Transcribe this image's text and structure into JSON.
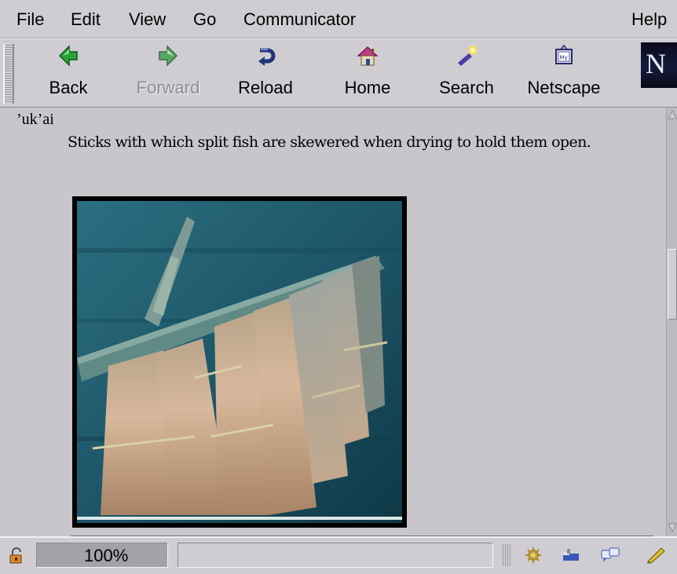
{
  "menu": {
    "items": [
      "File",
      "Edit",
      "View",
      "Go",
      "Communicator"
    ],
    "help": "Help"
  },
  "toolbar": {
    "back": "Back",
    "forward": "Forward",
    "reload": "Reload",
    "home": "Home",
    "search": "Search",
    "netscape": "Netscape",
    "logo": "N"
  },
  "content": {
    "term": "’uk’ai",
    "definition": "Sticks with which split fish are skewered when drying to hold them open."
  },
  "status": {
    "zoom": "100%"
  },
  "colors": {
    "chrome": "#cfcdd2",
    "page_background": "#c8c6cb",
    "photo_water": "#1f5a6a"
  },
  "icons": [
    "back-icon",
    "forward-icon",
    "reload-icon",
    "home-icon",
    "search-icon",
    "netscape-icon",
    "security-lock-icon",
    "navigator-icon",
    "mail-icon",
    "discussion-icon",
    "composer-icon"
  ]
}
